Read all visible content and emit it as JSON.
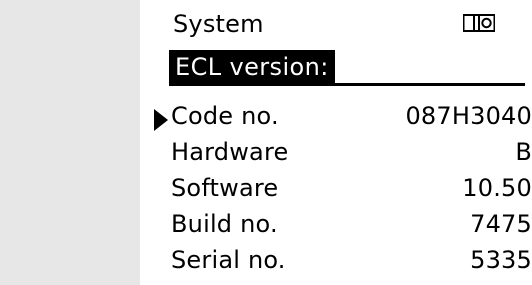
{
  "header": {
    "title": "System",
    "mode_icon": "mode-switch-icon"
  },
  "section": {
    "label": "ECL version:"
  },
  "rows": [
    {
      "label": "Code no.",
      "value": "087H3040",
      "selected": true
    },
    {
      "label": "Hardware",
      "value": "B",
      "selected": false
    },
    {
      "label": "Software",
      "value": "10.50",
      "selected": false
    },
    {
      "label": "Build no.",
      "value": "7475",
      "selected": false
    },
    {
      "label": "Serial no.",
      "value": "5335",
      "selected": false
    }
  ],
  "colors": {
    "foreground": "#000000",
    "background": "#ffffff",
    "gutter": "#e7e7e7"
  }
}
